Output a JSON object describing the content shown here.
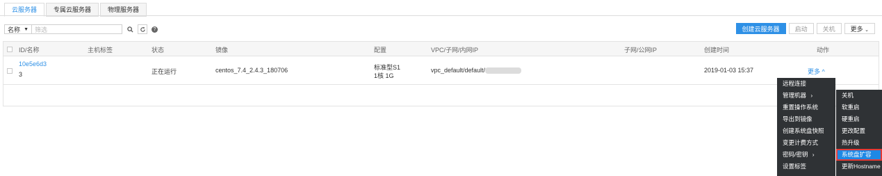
{
  "tabs": [
    "云服务器",
    "专属云服务器",
    "物理服务器"
  ],
  "filter": {
    "select_label": "名称",
    "search_placeholder": "筛选"
  },
  "actions": {
    "create": "创建云服务器",
    "start": "启动",
    "stop": "关机",
    "more": "更多"
  },
  "table": {
    "headers": [
      "ID/名称",
      "主机标签",
      "状态",
      "镜像",
      "配置",
      "VPC/子网/内网IP",
      "子网/公网IP",
      "创建时间",
      "动作"
    ],
    "row": {
      "id": "10e5e6d3",
      "name": "3",
      "status": "正在运行",
      "image": "centos_7.4_2.4.3_180706",
      "config_type": "标准型S1",
      "config_spec": "1核 1G",
      "vpc": "vpc_default/default/",
      "created": "2019-01-03 15:37",
      "action_more": "更多"
    }
  },
  "menu_main": [
    "远程连接",
    "管理机器",
    "重置操作系统",
    "导出到镜像",
    "创建系统盘快照",
    "变更计费方式",
    "密码/密钥",
    "设置标签"
  ],
  "menu_sub": [
    "关机",
    "软重启",
    "硬重启",
    "更改配置",
    "热升级",
    "系统盘扩容",
    "更新Hostname"
  ],
  "colors": {
    "accent": "#2e90e6",
    "menu_bg": "#2f3235",
    "highlight": "#1e88e5",
    "callout": "#e53935"
  }
}
